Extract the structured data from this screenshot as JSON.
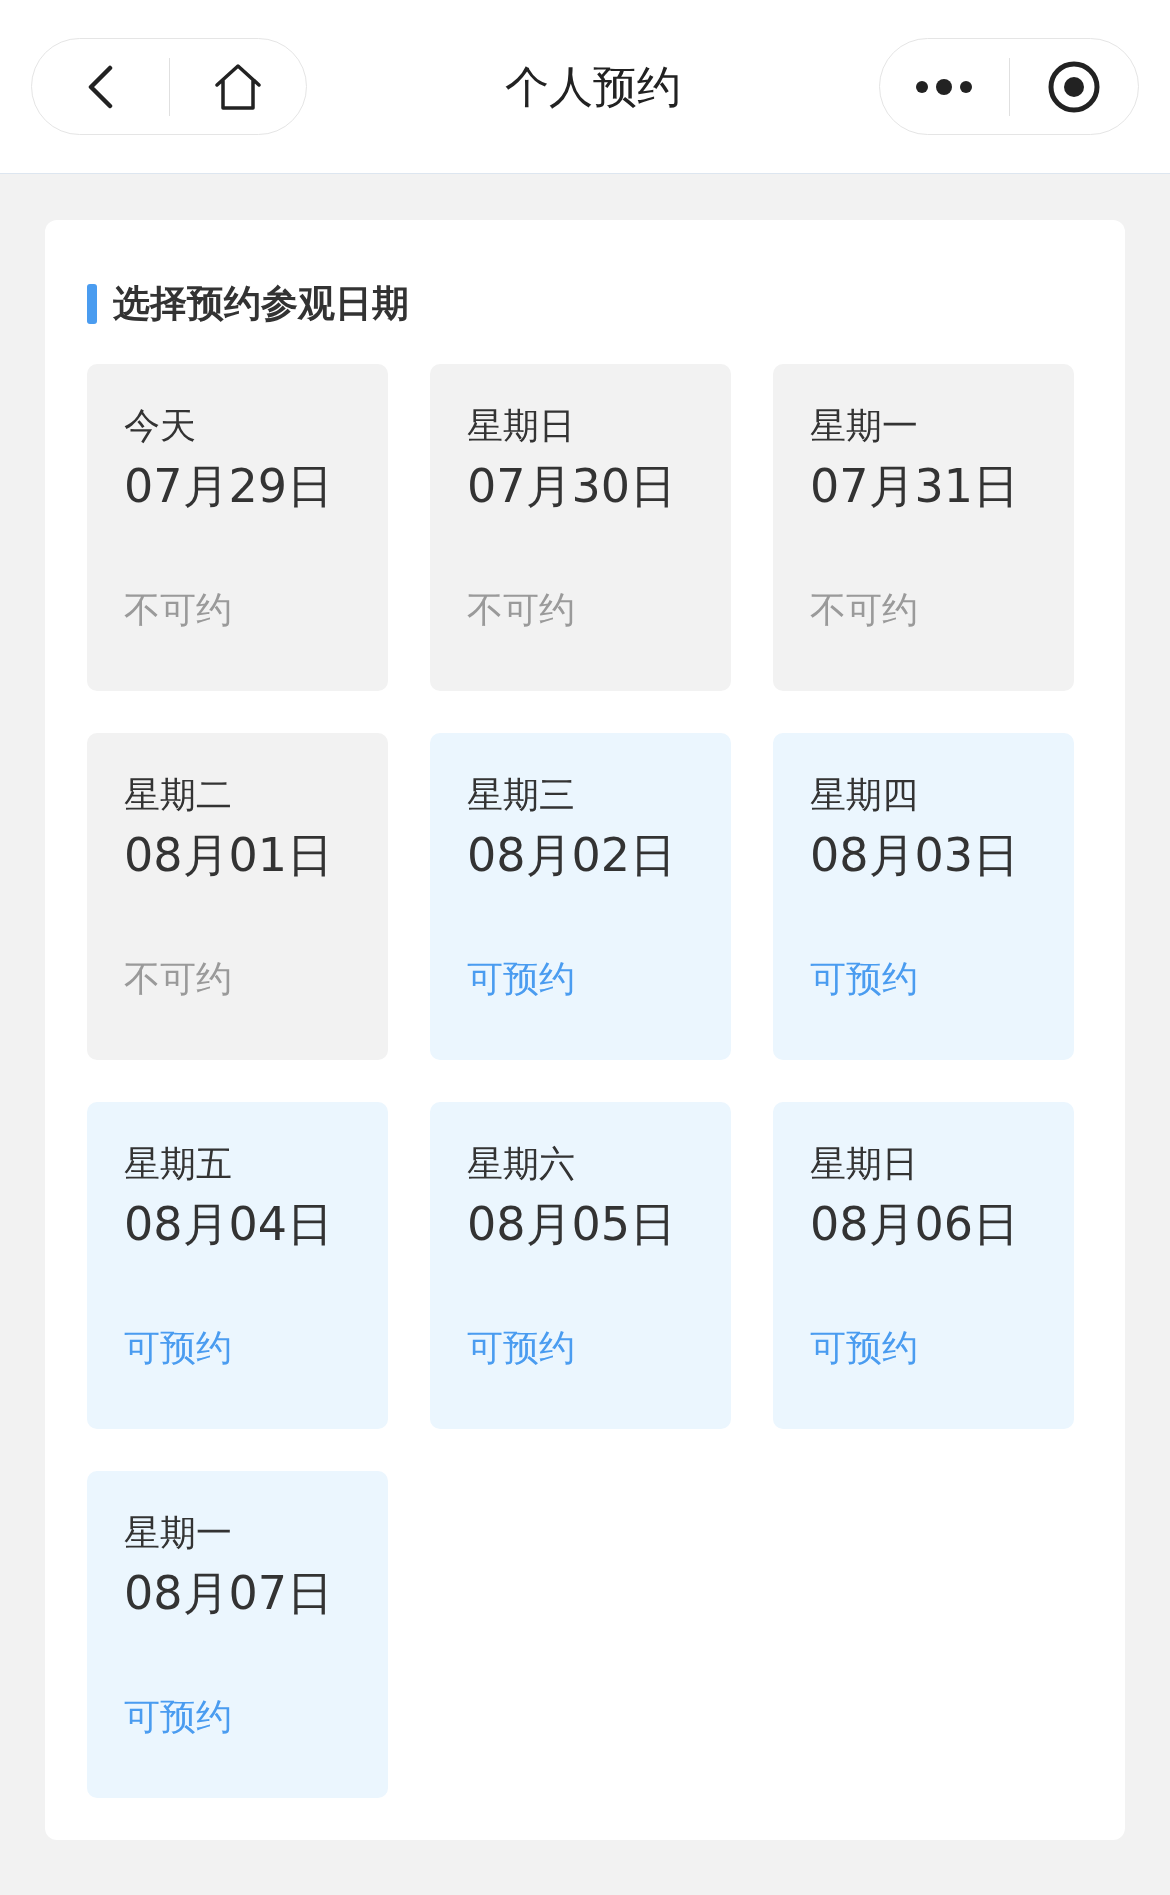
{
  "header": {
    "title": "个人预约"
  },
  "section": {
    "title": "选择预约参观日期"
  },
  "dates": [
    {
      "day": "今天",
      "date": "07月29日",
      "status": "不可约",
      "available": false
    },
    {
      "day": "星期日",
      "date": "07月30日",
      "status": "不可约",
      "available": false
    },
    {
      "day": "星期一",
      "date": "07月31日",
      "status": "不可约",
      "available": false
    },
    {
      "day": "星期二",
      "date": "08月01日",
      "status": "不可约",
      "available": false
    },
    {
      "day": "星期三",
      "date": "08月02日",
      "status": "可预约",
      "available": true
    },
    {
      "day": "星期四",
      "date": "08月03日",
      "status": "可预约",
      "available": true
    },
    {
      "day": "星期五",
      "date": "08月04日",
      "status": "可预约",
      "available": true
    },
    {
      "day": "星期六",
      "date": "08月05日",
      "status": "可预约",
      "available": true
    },
    {
      "day": "星期日",
      "date": "08月06日",
      "status": "可预约",
      "available": true
    },
    {
      "day": "星期一",
      "date": "08月07日",
      "status": "可预约",
      "available": true
    }
  ]
}
